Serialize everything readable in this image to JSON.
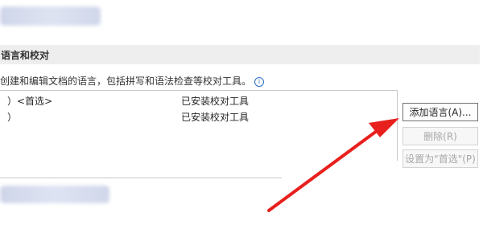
{
  "section": {
    "title": "语言和校对"
  },
  "description": {
    "text": "创建和编辑文档的语言，包括拼写和语法检查等校对工具。",
    "info_icon": "info-icon"
  },
  "languages": [
    {
      "name": "）<首选>",
      "status": "已安装校对工具"
    },
    {
      "name": "）",
      "status": "已安装校对工具"
    }
  ],
  "buttons": {
    "add_language": "添加语言(A)...",
    "delete": "删除(R)",
    "set_preferred": "设置为\"首选\"(P)"
  },
  "annotation": {
    "color": "#e8201d"
  }
}
